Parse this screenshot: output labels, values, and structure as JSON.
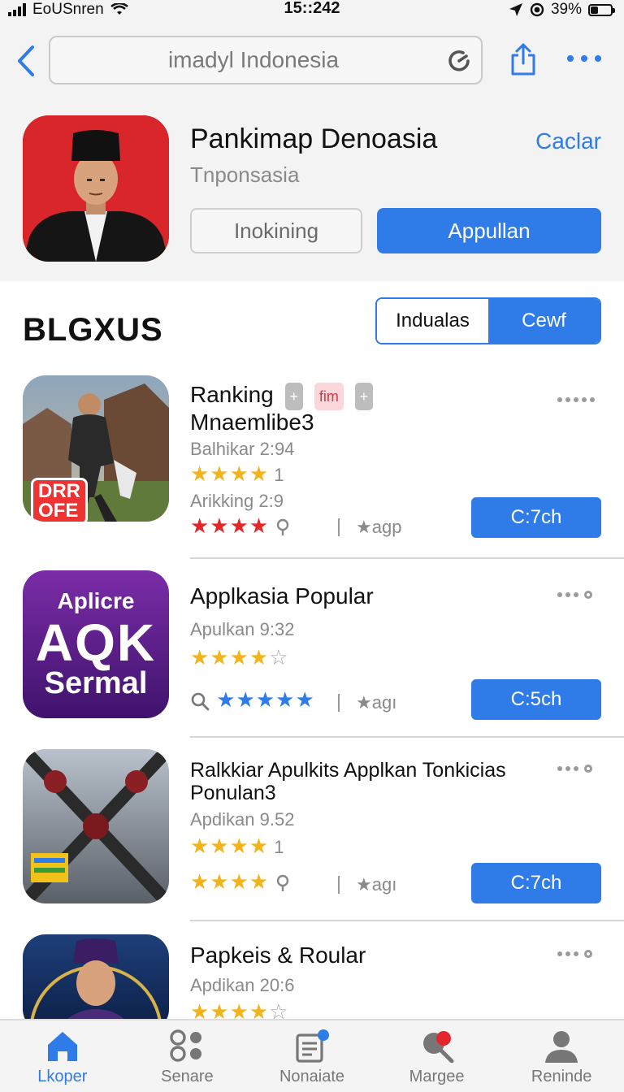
{
  "status_bar": {
    "carrier": "EoUSnren",
    "time": "15::242",
    "battery": "39%",
    "battery_level": 0.39
  },
  "nav": {
    "search_value": "imadyl Indonesia"
  },
  "hero": {
    "title": "Pankimap Denoasia",
    "subtitle": "Tnponsasia",
    "cancel_label": "Caclar",
    "secondary_label": "Inokining",
    "primary_label": "Appullan"
  },
  "section": {
    "title": "BLGXUS",
    "segments": [
      "Indualas",
      "Cewf"
    ],
    "active_segment": 0
  },
  "apps": [
    {
      "title_line1": "Ranking",
      "badges": [
        "+",
        "fim",
        "+"
      ],
      "title_line2": "Mnaemlibe3",
      "meta1": "Balhikar 2:94",
      "rating1_stars": "★★★★",
      "rating1_count": "1",
      "meta2": "Arikking 2:9",
      "rating2_stars": "★★★★",
      "tag": "★agp",
      "button": "C:7ch",
      "icon_text_1": "DRR",
      "icon_text_2": "OFE"
    },
    {
      "title": "Applkasia Popular",
      "meta1": "Apulkan 9:32",
      "rating1_stars": "★★★★",
      "rating2_stars": "★★★★★",
      "tag": "★agı",
      "button": "C:5ch",
      "icon_text_1": "Aplicre",
      "icon_text_2": "AQK",
      "icon_text_3": "Sermal"
    },
    {
      "title_line1": "Ralkkiar Apulkits Applkan Tonkicias",
      "title_line2": "Ponulan3",
      "meta1": "Apdikan 9.52",
      "rating1_stars": "★★★★",
      "rating1_count": "1",
      "rating2_stars": "★★★★",
      "tag": "★agı",
      "button": "C:7ch"
    },
    {
      "title": "Papkeis & Roular",
      "meta1": "Apdikan 20:6",
      "rating1_stars": "★★★★"
    }
  ],
  "tabs": [
    {
      "label": "Lkoper",
      "icon": "home-icon"
    },
    {
      "label": "Senare",
      "icon": "grid-icon"
    },
    {
      "label": "Nonaiate",
      "icon": "news-icon"
    },
    {
      "label": "Margee",
      "icon": "search-icon"
    },
    {
      "label": "Reninde",
      "icon": "person-icon"
    }
  ],
  "colors": {
    "accent": "#2f7be8",
    "star": "#f2b41c",
    "star_red": "#e3262b",
    "hero_icon_bg": "#d9262b"
  }
}
